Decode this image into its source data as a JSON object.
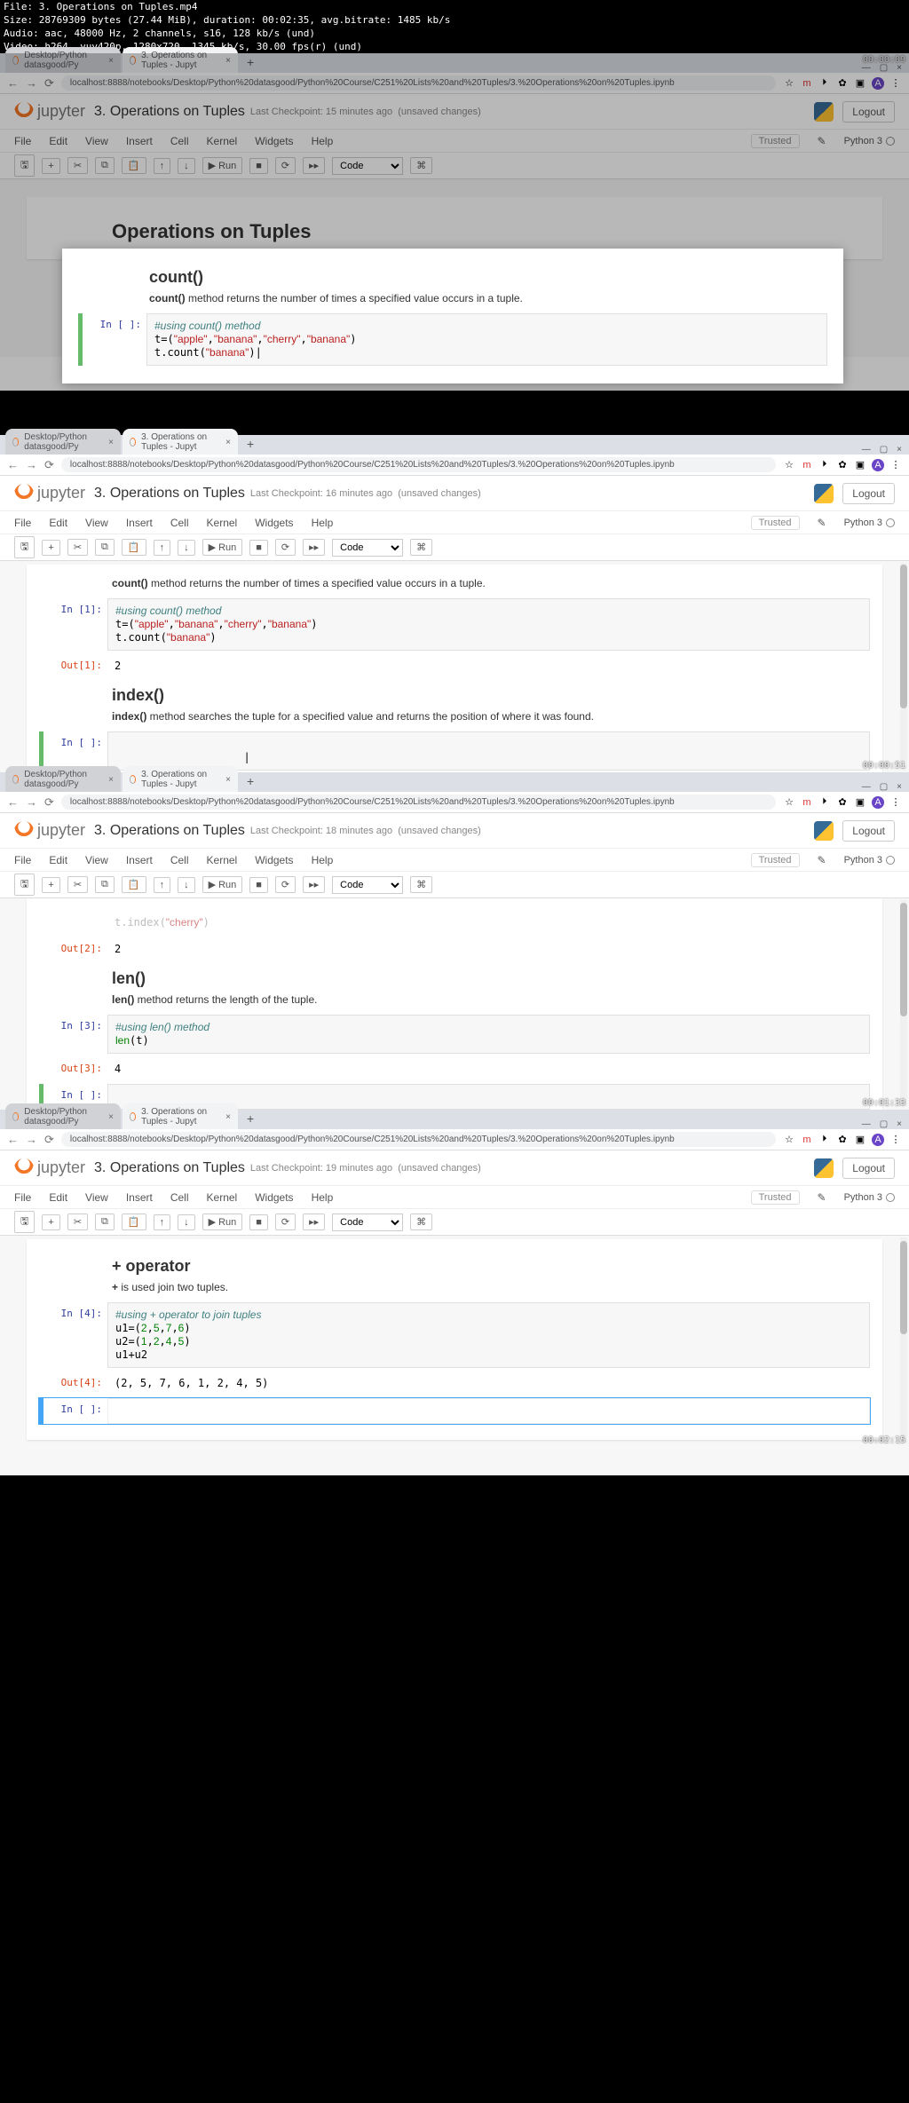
{
  "ffprobe_lines": [
    "File: 3. Operations on Tuples.mp4",
    "Size: 28769309 bytes (27.44 MiB), duration: 00:02:35, avg.bitrate: 1485 kb/s",
    "Audio: aac, 48000 Hz, 2 channels, s16, 128 kb/s (und)",
    "Video: h264, yuv420p, 1280x720, 1345 kb/s, 30.00 fps(r) (und)"
  ],
  "browser": {
    "tab0": "Desktop/Python datasgood/Py",
    "tab1": "3. Operations on Tuples - Jupyt",
    "url": "localhost:8888/notebooks/Desktop/Python%20datasgood/Python%20Course/C251%20Lists%20and%20Tuples/3.%20Operations%20on%20Tuples.ipynb",
    "avatar": "A"
  },
  "jupyter": {
    "brand": "jupyter",
    "title": "3. Operations on Tuples",
    "checkpoint_15": "Last Checkpoint: 15 minutes ago",
    "checkpoint_16": "Last Checkpoint: 16 minutes ago",
    "checkpoint_18": "Last Checkpoint: 18 minutes ago",
    "checkpoint_19": "Last Checkpoint: 19 minutes ago",
    "unsaved": "(unsaved changes)",
    "logout": "Logout",
    "menu_file": "File",
    "menu_edit": "Edit",
    "menu_view": "View",
    "menu_insert": "Insert",
    "menu_cell": "Cell",
    "menu_kernel": "Kernel",
    "menu_widgets": "Widgets",
    "menu_help": "Help",
    "trusted": "Trusted",
    "kernel_name": "Python 3",
    "run_label": "Run",
    "celltype": "Code"
  },
  "nb": {
    "h1_operations": "Operations on Tuples",
    "h2_count": "count()",
    "p_count": "count() method returns the number of times a specified value occurs in a tuple.",
    "code_count_l1": "#using count() method",
    "code_count_l2a": "t=(",
    "code_count_l2a_bracket": "t=(",
    "code_count_str1": "\"apple\"",
    "code_count_str2": "\"banana\"",
    "code_count_str3": "\"cherry\"",
    "code_count_str4": "\"banana\"",
    "code_count_l3a": "t.count(",
    "code_count_l3b": "\"banana\"",
    "out1_val": "2",
    "h2_index": "index()",
    "p_index": "index() method searches the tuple for a specified value and returns the position of where it was found.",
    "code_index_tail": "t.index(\"cherry\")",
    "out2_val": "2",
    "h2_len": "len()",
    "p_len": "len() method returns the length of the tuple.",
    "code_len_l1": "#using len() method",
    "code_len_l2": "len(t)",
    "out3_val": "4",
    "h2_plus": "+ operator",
    "p_plus": "+ is used join two tuples.",
    "code_plus_l1": "#using + operator to join tuples",
    "code_plus_l2": "u1=(2,5,7,6)",
    "code_plus_l3": "u2=(1,2,4,5)",
    "code_plus_l4": "u1+u2",
    "out4_val": "(2, 5, 7, 6, 1, 2, 4, 5)"
  },
  "prompts": {
    "in_blank": "In [ ]:",
    "in1": "In [1]:",
    "out1": "Out[1]:",
    "out2": "Out[2]:",
    "in3": "In [3]:",
    "out3": "Out[3]:",
    "in4": "In [4]:",
    "out4": "Out[4]:"
  },
  "timestamps": {
    "t1": "00:00:09",
    "t2": "00:00:51",
    "t3": "00:01:33",
    "t4": "00:02:15"
  }
}
